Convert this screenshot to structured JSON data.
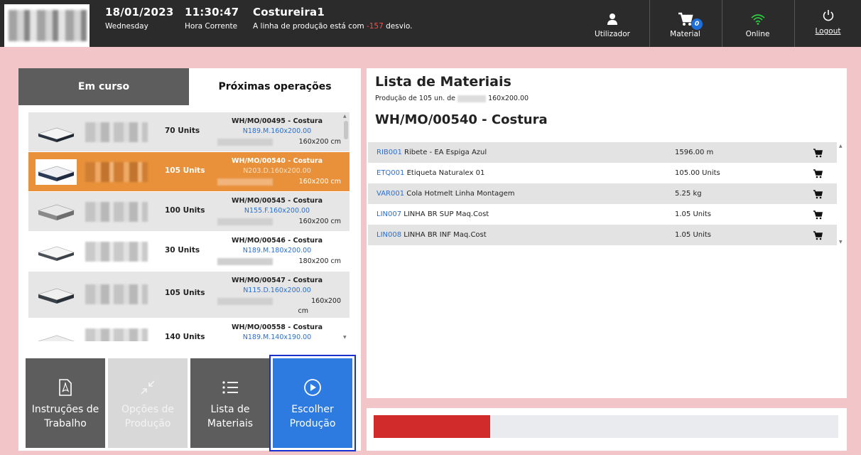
{
  "topbar": {
    "date": "18/01/2023",
    "weekday": "Wednesday",
    "time": "11:30:47",
    "time_label": "Hora Corrente",
    "workstation": "Costureira1",
    "deviation_prefix": "A linha de produção está com ",
    "deviation_value": "-157",
    "deviation_suffix": " desvio.",
    "user_label": "Utilizador",
    "material_label": "Material",
    "material_badge": "0",
    "online_label": "Online",
    "logout_label": "Logout",
    "colors": {
      "bar": "#2b2b2b",
      "online": "#2ecc40",
      "badge": "#1e6fd9",
      "negative": "#ff4d4d"
    }
  },
  "left": {
    "tabs": [
      {
        "label": "Em curso",
        "active": true
      },
      {
        "label": "Próximas operações",
        "active": false
      }
    ],
    "orders": [
      {
        "units": "70 Units",
        "mo": "WH/MO/00495 - Costura",
        "code": "N189.M.160x200.00",
        "dim": "160x200 cm",
        "state": "gray"
      },
      {
        "units": "105 Units",
        "mo": "WH/MO/00540 - Costura",
        "code": "N203.D.160x200.00",
        "dim": "160x200 cm",
        "state": "selected"
      },
      {
        "units": "100 Units",
        "mo": "WH/MO/00545 - Costura",
        "code": "N155.F.160x200.00",
        "dim": "160x200 cm",
        "state": "gray"
      },
      {
        "units": "30 Units",
        "mo": "WH/MO/00546 - Costura",
        "code": "N189.M.180x200.00",
        "dim": "180x200 cm",
        "state": "white"
      },
      {
        "units": "105 Units",
        "mo": "WH/MO/00547 - Costura",
        "code": "N115.D.160x200.00",
        "dim": "160x200",
        "dim2": "cm",
        "state": "gray"
      },
      {
        "units": "140 Units",
        "mo": "WH/MO/00558 - Costura",
        "code": "N189.M.140x190.00",
        "dim": "",
        "state": "white"
      }
    ],
    "buttons": [
      {
        "label1": "Instruções de",
        "label2": "Trabalho",
        "icon": "pdf-icon",
        "enabled": true
      },
      {
        "label1": "Opções de",
        "label2": "Produção",
        "icon": "collapse-arrows-icon",
        "enabled": false
      },
      {
        "label1": "Lista de",
        "label2": "Materiais",
        "icon": "list-icon",
        "enabled": true
      },
      {
        "label1": "Escolher",
        "label2": "Produção",
        "icon": "play-circle-icon",
        "enabled": true
      }
    ]
  },
  "right": {
    "title": "Lista de Materiais",
    "subtitle_prefix": "Produção de 105 un. de",
    "subtitle_suffix": "160x200.00",
    "mo_title": "WH/MO/00540 - Costura",
    "materials": [
      {
        "code": "RIB001",
        "name": "Ribete - EA Espiga Azul",
        "qty": "1596.00 m"
      },
      {
        "code": "ETQ001",
        "name": "Etiqueta Naturalex 01",
        "qty": "105.00 Units"
      },
      {
        "code": "VAR001",
        "name": "Cola Hotmelt Linha Montagem",
        "qty": "5.25 kg"
      },
      {
        "code": "LIN007",
        "name": "LINHA BR SUP Maq.Cost",
        "qty": "1.05 Units"
      },
      {
        "code": "LIN008",
        "name": "LINHA BR INF Maq.Cost",
        "qty": "1.05 Units"
      }
    ]
  },
  "progress": {
    "fraction": 0.25,
    "color": "#d22b2b"
  }
}
